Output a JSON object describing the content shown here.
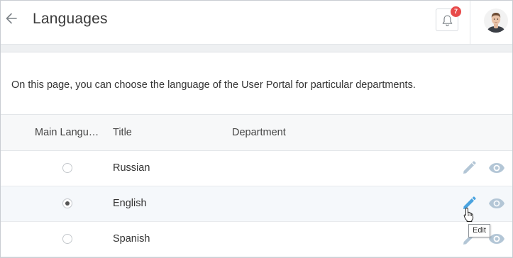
{
  "header": {
    "title": "Languages",
    "back_icon": "arrow-left-icon",
    "notifications_icon": "bell-icon",
    "notification_count": "7",
    "avatar": "user-avatar"
  },
  "description": "On this page, you can choose the language of the User Portal for particular departments.",
  "table": {
    "columns": [
      "Main Langua…",
      "Title",
      "Department"
    ],
    "rows": [
      {
        "main": false,
        "title": "Russian",
        "department": ""
      },
      {
        "main": true,
        "title": "English",
        "department": ""
      },
      {
        "main": false,
        "title": "Spanish",
        "department": ""
      }
    ],
    "row_actions": [
      "pencil-icon",
      "eye-icon"
    ]
  },
  "tooltip": "Edit",
  "colors": {
    "accent_blue": "#4aa3df",
    "icon_muted": "#b3c6d6",
    "badge_red": "#e84a4a"
  }
}
